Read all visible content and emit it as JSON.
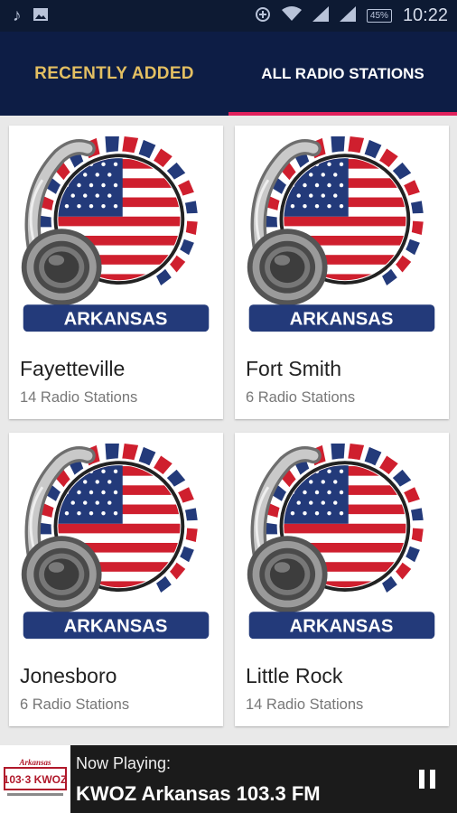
{
  "status_bar": {
    "time": "10:22",
    "battery": "45%",
    "left_icons": [
      "music-note-icon",
      "image-icon"
    ],
    "right_icons": [
      "data-saver-icon",
      "wifi-icon",
      "signal-icon",
      "signal-icon"
    ]
  },
  "tabs": [
    {
      "label": "RECENTLY ADDED",
      "selected": false
    },
    {
      "label": "ALL RADIO STATIONS",
      "selected": true
    }
  ],
  "cards": [
    {
      "art_text": "ARKANSAS",
      "name": "Fayetteville",
      "count": "14 Radio Stations"
    },
    {
      "art_text": "ARKANSAS",
      "name": "Fort Smith",
      "count": "6 Radio Stations"
    },
    {
      "art_text": "ARKANSAS",
      "name": "Jonesboro",
      "count": "6 Radio Stations"
    },
    {
      "art_text": "ARKANSAS",
      "name": "Little Rock",
      "count": "14 Radio Stations"
    }
  ],
  "player": {
    "logo_top": "Arkansas",
    "logo_main": "103·3 KWOZ",
    "label": "Now Playing:",
    "title": "KWOZ Arkansas 103.3 FM",
    "control_icon": "pause-icon"
  },
  "colors": {
    "appbar": "#0d1d45",
    "tab_active_indicator": "#e0215c",
    "tab_inactive_text": "#e3bf62",
    "banner_blue": "#233a7a",
    "flag_red": "#cf1f2e"
  }
}
